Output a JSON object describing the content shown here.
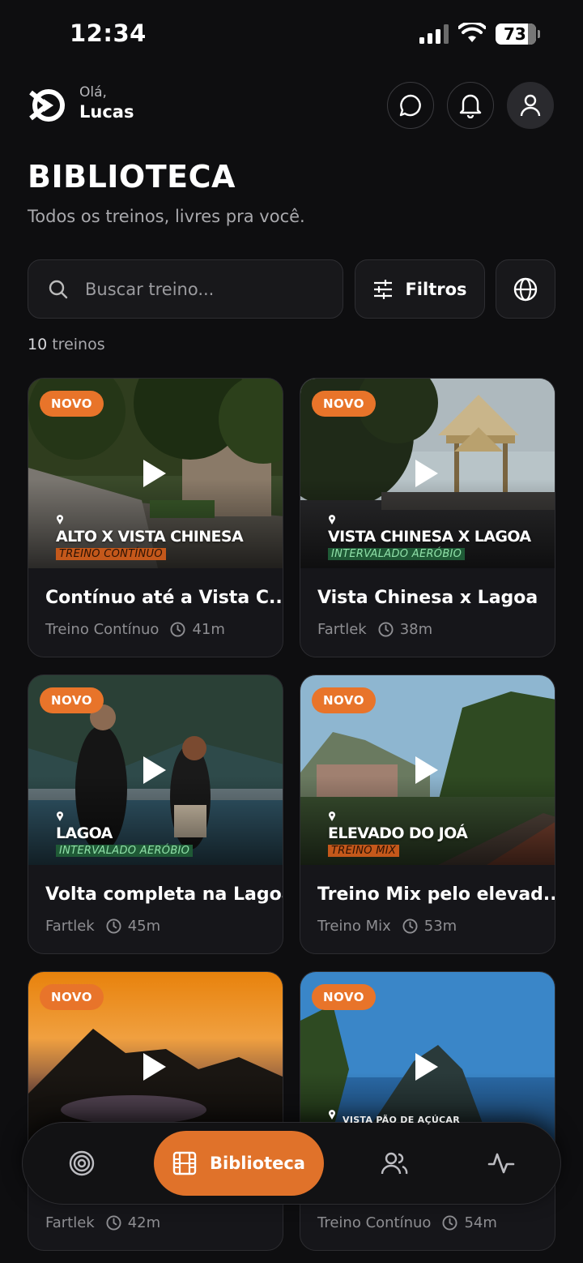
{
  "status_bar": {
    "time": "12:34",
    "battery": "73"
  },
  "header": {
    "greeting": "Olá,",
    "username": "Lucas"
  },
  "page": {
    "title": "BIBLIOTECA",
    "subtitle": "Todos os treinos, livres pra você."
  },
  "search": {
    "placeholder": "Buscar treino...",
    "filters_label": "Filtros"
  },
  "results": {
    "count": "10",
    "count_label": "treinos"
  },
  "cards": [
    {
      "badge": "NOVO",
      "overlay_title": "ALTO X VISTA CHINESA",
      "overlay_tag": "TREINO CONTÍNUO",
      "name": "Contínuo até a Vista C...",
      "type": "Treino Contínuo",
      "duration": "41m"
    },
    {
      "badge": "NOVO",
      "overlay_title": "VISTA CHINESA X LAGOA",
      "overlay_tag": "INTERVALADO AERÓBIO",
      "name": "Vista Chinesa x Lagoa",
      "type": "Fartlek",
      "duration": "38m"
    },
    {
      "badge": "NOVO",
      "overlay_title": "LAGOA",
      "overlay_tag": "INTERVALADO AERÓBIO",
      "name": "Volta completa na Lagoa",
      "type": "Fartlek",
      "duration": "45m"
    },
    {
      "badge": "NOVO",
      "overlay_title": "ELEVADO DO JOÁ",
      "overlay_tag": "TREINO MIX",
      "name": "Treino Mix pelo elevad...",
      "type": "Treino Mix",
      "duration": "53m"
    },
    {
      "badge": "NOVO",
      "type": "Fartlek",
      "duration": "42m"
    },
    {
      "badge": "NOVO",
      "overlay_small": "VISTA PÃO DE AÇÚCAR",
      "type": "Treino Contínuo",
      "duration": "54m"
    }
  ],
  "nav": {
    "active_label": "Biblioteca"
  },
  "colors": {
    "accent": "#e0722a",
    "background": "#0e0e10",
    "card": "#16161a"
  }
}
